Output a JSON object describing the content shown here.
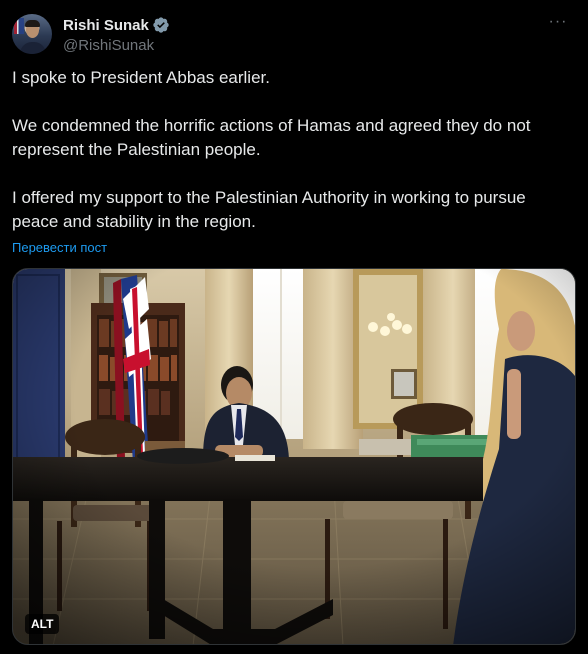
{
  "author": {
    "display_name": "Rishi Sunak",
    "handle": "@RishiSunak",
    "verified": true,
    "avatar_icon": "profile-avatar-icon"
  },
  "menu": {
    "more_icon": "more-options-icon",
    "more_label": "···"
  },
  "post": {
    "paragraphs": [
      "I spoke to President Abbas earlier.",
      "We condemned the horrific actions of Hamas and agreed they do not represent the Palestinian people.",
      "I offered my support to the Palestinian Authority in working to pursue peace and stability in the region."
    ],
    "translate_label": "Перевести пост"
  },
  "media": {
    "alt_label": "ALT"
  },
  "colors": {
    "background": "#000000",
    "text_primary": "#e7e9ea",
    "text_secondary": "#71767b",
    "accent": "#1d9bf0",
    "verified_badge": "#829aab"
  }
}
